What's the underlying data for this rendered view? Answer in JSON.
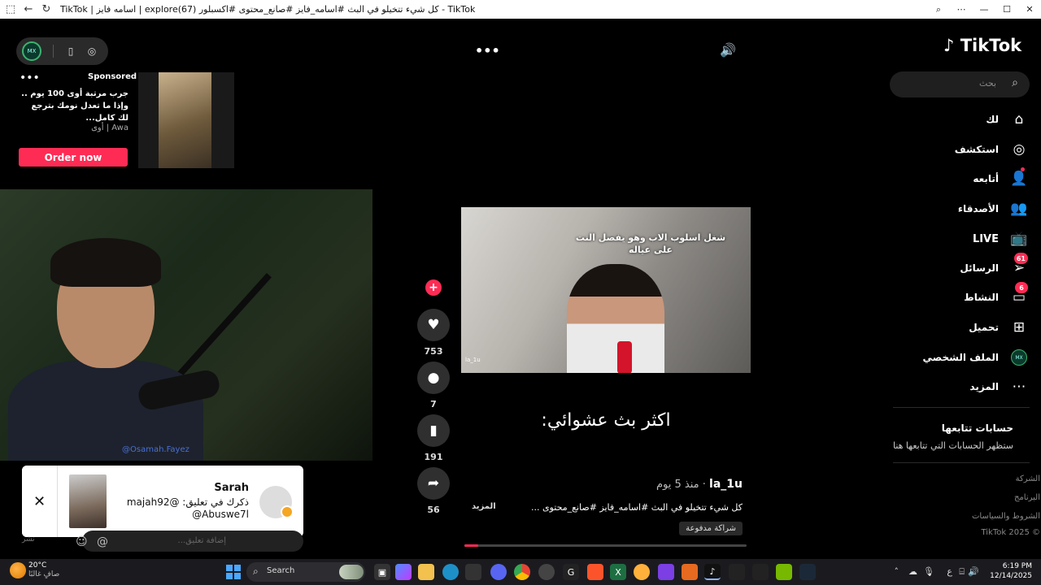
{
  "window": {
    "title": "TikTok | اسامه فايز | exploreكل شيء تتخيلو في البث #اسامه_فايز #صانع_محتوى #اكسبلور (67) - TikTok",
    "refresh_icon": "refresh-icon",
    "back_icon": "back-arrow-icon"
  },
  "left_panel": {
    "ad": {
      "sponsored": "Sponsored",
      "text": "جرب مرتبة أوى 100 يوم .. وإذا ما تعدل نومك بترجع لك كامل...",
      "brand": "Awa | أوى",
      "cta": "Order now"
    },
    "webcam_handle": "@Osamah.Fayez"
  },
  "notification": {
    "name": "Sarah",
    "message": "ذكرك في تعليق: @majah92 @Abuswe7l",
    "close": "✕"
  },
  "comment_box": {
    "send": "نشر",
    "placeholder": "إضافة تعليق..."
  },
  "video": {
    "caption_overlay": "شغل اسلوب الاب وهو يفصل النت على عياله",
    "watermark": "la_1u",
    "big_text": "اكثر بث عشوائي:",
    "author": "la_1u",
    "time": "منذ 5 يوم",
    "description": "كل شيء تتخيلو في البث #اسامه_فايز #صانع_محتوى ...",
    "more": "المزيد",
    "paid_partnership": "شراكة مدفوعة",
    "progress": 0.05
  },
  "actions": {
    "likes": "753",
    "comments": "7",
    "saves": "191",
    "shares": "56"
  },
  "sidebar": {
    "logo": "TikTok",
    "search_placeholder": "بحث",
    "items": [
      {
        "label": "لك",
        "icon": "home-icon"
      },
      {
        "label": "استكشف",
        "icon": "compass-icon"
      },
      {
        "label": "أتابعه",
        "icon": "user-follow-icon"
      },
      {
        "label": "الأصدقاء",
        "icon": "friends-icon"
      },
      {
        "label": "LIVE",
        "icon": "live-tv-icon"
      },
      {
        "label": "الرسائل",
        "icon": "send-icon",
        "badge": "61"
      },
      {
        "label": "النشاط",
        "icon": "inbox-icon",
        "badge": "6"
      },
      {
        "label": "تحميل",
        "icon": "upload-icon"
      },
      {
        "label": "الملف الشخصي",
        "icon": "avatar-icon"
      },
      {
        "label": "المزيد",
        "icon": "more-dots-icon"
      }
    ],
    "following_title": "حسابات تتابعها",
    "following_hint": "ستظهر الحسابات التي تتابعها هنا",
    "footer": [
      "الشركة",
      "البرنامج",
      "الشروط والسياسات",
      "© 2025 TikTok"
    ]
  },
  "taskbar": {
    "temperature": "20°C",
    "weather_desc": "صافٍ غالبًا",
    "search": "Search",
    "time": "6:19 PM",
    "date": "12/14/2025",
    "lang": "ع"
  }
}
